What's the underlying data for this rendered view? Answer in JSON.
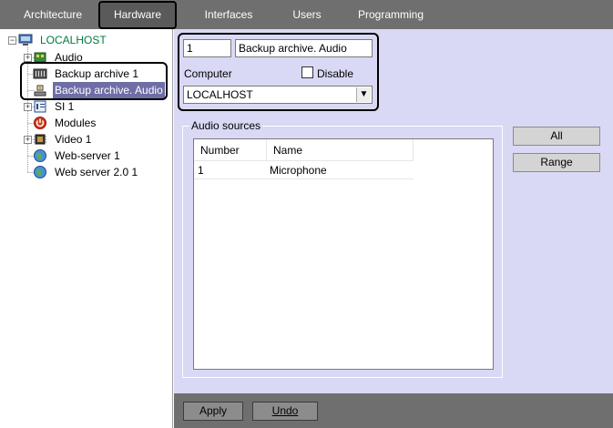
{
  "tabs": [
    {
      "label": "Architecture",
      "active": false
    },
    {
      "label": "Hardware",
      "active": true
    },
    {
      "label": "Interfaces",
      "active": false
    },
    {
      "label": "Users",
      "active": false
    },
    {
      "label": "Programming",
      "active": false
    }
  ],
  "tree": {
    "root": "LOCALHOST",
    "items": [
      {
        "label": "Audio",
        "icon": "audio-board-icon"
      },
      {
        "label": "Backup archive 1",
        "icon": "archive-icon"
      },
      {
        "label": "Backup archive. Audio",
        "icon": "audio-archive-icon",
        "selected": true
      },
      {
        "label": "SI 1",
        "icon": "si-icon"
      },
      {
        "label": "Modules",
        "icon": "power-icon"
      },
      {
        "label": "Video 1",
        "icon": "chip-icon"
      },
      {
        "label": "Web-server 1",
        "icon": "globe-icon"
      },
      {
        "label": "Web server 2.0 1",
        "icon": "globe-icon"
      }
    ]
  },
  "form": {
    "id_value": "1",
    "name_value": "Backup archive. Audio",
    "computer_label": "Computer",
    "disable_label": "Disable",
    "computer_value": "LOCALHOST"
  },
  "audio_sources": {
    "title": "Audio sources",
    "columns": [
      "Number",
      "Name"
    ],
    "rows": [
      {
        "number": "1",
        "name": "Microphone"
      }
    ]
  },
  "buttons": {
    "all": "All",
    "range": "Range",
    "apply": "Apply",
    "undo": "Undo"
  },
  "colors": {
    "tabbar": "#6f6f6f",
    "panel": "#d9d9f5",
    "selection": "#6d6ea6",
    "tree_root": "#007a3d"
  }
}
